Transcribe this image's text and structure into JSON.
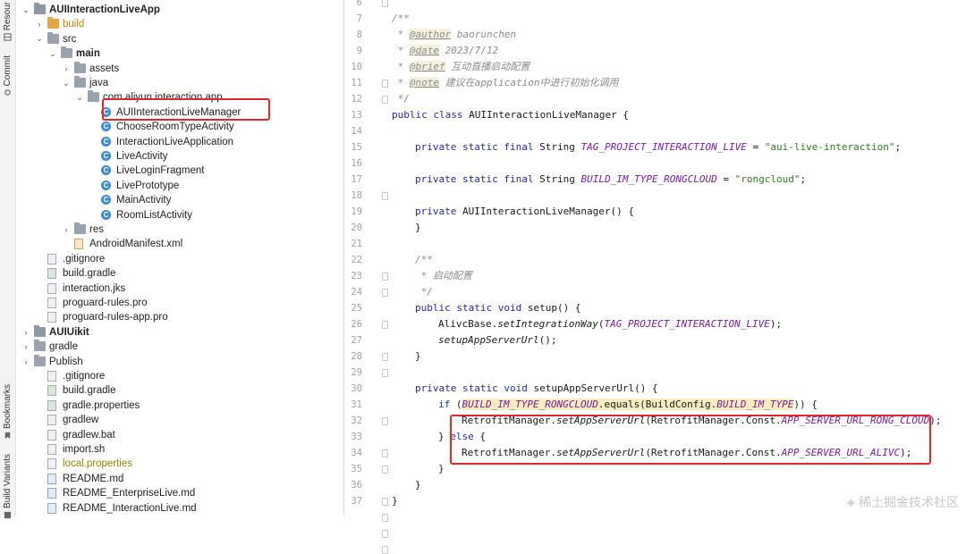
{
  "sidebar_tabs": {
    "resource": "Resour",
    "commit": "Commit",
    "bookmarks": "Bookmarks",
    "build_variants": "Build Variants"
  },
  "tree": [
    {
      "label": "AUIInteractionLiveApp",
      "type": "module",
      "arrow": "open",
      "bold": true
    },
    {
      "label": "build",
      "type": "folder-orange",
      "arrow": "closed",
      "color": "orange"
    },
    {
      "label": "src",
      "type": "folder",
      "arrow": "open"
    },
    {
      "label": "main",
      "type": "folder",
      "arrow": "open",
      "bold": true
    },
    {
      "label": "assets",
      "type": "folder",
      "arrow": "closed"
    },
    {
      "label": "java",
      "type": "folder",
      "arrow": "open"
    },
    {
      "label": "com.aliyun.interaction.app",
      "type": "folder",
      "arrow": "open"
    },
    {
      "label": "AUIInteractionLiveManager",
      "type": "class"
    },
    {
      "label": "ChooseRoomTypeActivity",
      "type": "class"
    },
    {
      "label": "InteractionLiveApplication",
      "type": "class"
    },
    {
      "label": "LiveActivity",
      "type": "class"
    },
    {
      "label": "LiveLoginFragment",
      "type": "class"
    },
    {
      "label": "LivePrototype",
      "type": "class"
    },
    {
      "label": "MainActivity",
      "type": "class"
    },
    {
      "label": "RoomListActivity",
      "type": "class"
    },
    {
      "label": "res",
      "type": "folder",
      "arrow": "closed"
    },
    {
      "label": "AndroidManifest.xml",
      "type": "xml"
    },
    {
      "label": ".gitignore",
      "type": "file"
    },
    {
      "label": "build.gradle",
      "type": "gradle"
    },
    {
      "label": "interaction.jks",
      "type": "file"
    },
    {
      "label": "proguard-rules.pro",
      "type": "file"
    },
    {
      "label": "proguard-rules-app.pro",
      "type": "file"
    },
    {
      "label": "AUIUikit",
      "type": "module",
      "arrow": "closed",
      "bold": true
    },
    {
      "label": "gradle",
      "type": "folder",
      "arrow": "closed"
    },
    {
      "label": "Publish",
      "type": "folder",
      "arrow": "closed"
    },
    {
      "label": ".gitignore",
      "type": "file"
    },
    {
      "label": "build.gradle",
      "type": "gradle"
    },
    {
      "label": "gradle.properties",
      "type": "gradle"
    },
    {
      "label": "gradlew",
      "type": "file"
    },
    {
      "label": "gradlew.bat",
      "type": "file"
    },
    {
      "label": "import.sh",
      "type": "file"
    },
    {
      "label": "local.properties",
      "type": "file",
      "color": "olive"
    },
    {
      "label": "README.md",
      "type": "md"
    },
    {
      "label": "README_EnterpriseLive.md",
      "type": "md"
    },
    {
      "label": "README_InteractionLive.md",
      "type": "md"
    }
  ],
  "editor": {
    "line_numbers": [
      "6",
      "7",
      "8",
      "9",
      "10",
      "11",
      "12",
      "13",
      "14",
      "15",
      "16",
      "17",
      "18",
      "19",
      "20",
      "21",
      "22",
      "23",
      "24",
      "25",
      "26",
      "27",
      "28",
      "29",
      "30",
      "31",
      "32",
      "33",
      "34",
      "35",
      "36",
      "37"
    ],
    "code": {
      "javadoc_open": "/**",
      "javadoc_star": " * ",
      "author_tag": "@author",
      "author_val": " baorunchen",
      "date_tag": "@date",
      "date_val": " 2023/7/12",
      "brief_tag": "@brief",
      "brief_val": " 互动直播启动配置",
      "note_tag": "@note",
      "note_val": " 建议在application中进行初始化调用",
      "javadoc_close": " */",
      "kw_public": "public",
      "kw_class": "class",
      "class_name": " AUIInteractionLiveManager {",
      "kw_private": "private",
      "kw_static": "static",
      "kw_final": "final",
      "kw_void": "void",
      "kw_if": "if",
      "kw_else": "else",
      "type_string": " String ",
      "const1": "TAG_PROJECT_INTERACTION_LIVE",
      "val1": "\"aui-live-interaction\"",
      "const2": "BUILD_IM_TYPE_RONGCLOUD",
      "val2": "\"rongcloud\"",
      "eq": " = ",
      "semi": ";",
      "ctor_name": " AUIInteractionLiveManager",
      "ctor_parens": "() {",
      "close_brace": "}",
      "comment2_open": "/**",
      "comment2_body": " * 启动配置",
      "comment2_close": " */",
      "setup_sig": " setup() {",
      "alivc_base": "AlivcBase.",
      "set_integration": "setIntegrationWay",
      "lparen": "(",
      "rparen_semi": ");",
      "setup_call": "setupAppServerUrl",
      "call_tail": "();",
      "setup_url_sig": " setupAppServerUrl() {",
      "if_open": " (",
      "equals_mid": ".equals(BuildConfig.",
      "build_im_type": "BUILD_IM_TYPE",
      "if_close": ")) {",
      "retrofit": "RetrofitManager.",
      "set_app_url": "setAppServerUrl",
      "retrofit_const": "(RetrofitManager.Const.",
      "url_rong": "APP_SERVER_URL_RONG_CLOUD",
      "url_alivc": "APP_SERVER_URL_ALIVC",
      "else_prefix": "} ",
      "else_suffix": " {"
    }
  },
  "watermark": "稀土掘金技术社区",
  "colors": {
    "highlight_box": "#e3262d",
    "keyword": "#1d2fa6",
    "constant": "#7a1f9c",
    "string": "#2e7d22",
    "comment": "#8c8c8c"
  }
}
